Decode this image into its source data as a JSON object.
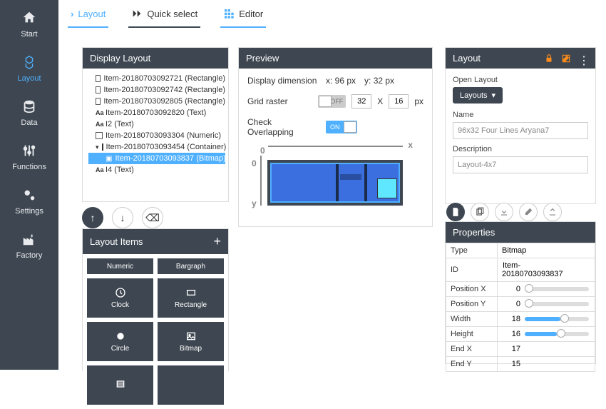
{
  "sidebar": [
    {
      "key": "start",
      "label": "Start"
    },
    {
      "key": "layout",
      "label": "Layout"
    },
    {
      "key": "data",
      "label": "Data"
    },
    {
      "key": "functions",
      "label": "Functions"
    },
    {
      "key": "settings",
      "label": "Settings"
    },
    {
      "key": "factory",
      "label": "Factory"
    }
  ],
  "tabs": {
    "layout": "Layout",
    "quick": "Quick select",
    "editor": "Editor"
  },
  "displayLayout": {
    "title": "Display Layout",
    "items": [
      {
        "t": "rect",
        "label": "Item-20180703092721 (Rectangle)"
      },
      {
        "t": "rect",
        "label": "Item-20180703092742 (Rectangle)"
      },
      {
        "t": "rect",
        "label": "Item-20180703092805 (Rectangle)"
      },
      {
        "t": "aa",
        "label": "Item-20180703092820 (Text)"
      },
      {
        "t": "aa",
        "label": "I2 (Text)"
      },
      {
        "t": "rect",
        "label": "Item-20180703093304 (Numeric)"
      },
      {
        "t": "caret",
        "label": "Item-20180703093454 (Container)"
      },
      {
        "t": "img",
        "label": "Item-20180703093837 (Bitmap)",
        "selected": true,
        "indent": true
      },
      {
        "t": "aa",
        "label": "I4 (Text)"
      }
    ]
  },
  "layoutItems": {
    "title": "Layout Items",
    "cells": [
      "Numeric",
      "Bargraph",
      "Clock",
      "Rectangle",
      "Circle",
      "Bitmap"
    ]
  },
  "preview": {
    "title": "Preview",
    "dim_label": "Display dimension",
    "x_label": "x: 96 px",
    "y_label": "y: 32 px",
    "grid_label": "Grid raster",
    "grid_on": "OFF",
    "gw": "32",
    "gh": "16",
    "px": "px",
    "x": "X",
    "overlap_label": "Check Overlapping",
    "overlap_on": "ON"
  },
  "layoutPanel": {
    "title": "Layout",
    "open_label": "Open Layout",
    "dd": "Layouts",
    "name_label": "Name",
    "name_val": "96x32 Four Lines Aryana7",
    "desc_label": "Description",
    "desc_val": "Layout-4x7"
  },
  "props": {
    "title": "Properties",
    "rows": [
      {
        "k": "Type",
        "v": "Bitmap"
      },
      {
        "k": "ID",
        "v": "Item-20180703093837"
      },
      {
        "k": "Position X",
        "v": "0",
        "slider": 0
      },
      {
        "k": "Position Y",
        "v": "0",
        "slider": 0
      },
      {
        "k": "Width",
        "v": "18",
        "slider": 55
      },
      {
        "k": "Height",
        "v": "16",
        "slider": 50
      },
      {
        "k": "End X",
        "v": "17"
      },
      {
        "k": "End Y",
        "v": "15"
      }
    ]
  }
}
